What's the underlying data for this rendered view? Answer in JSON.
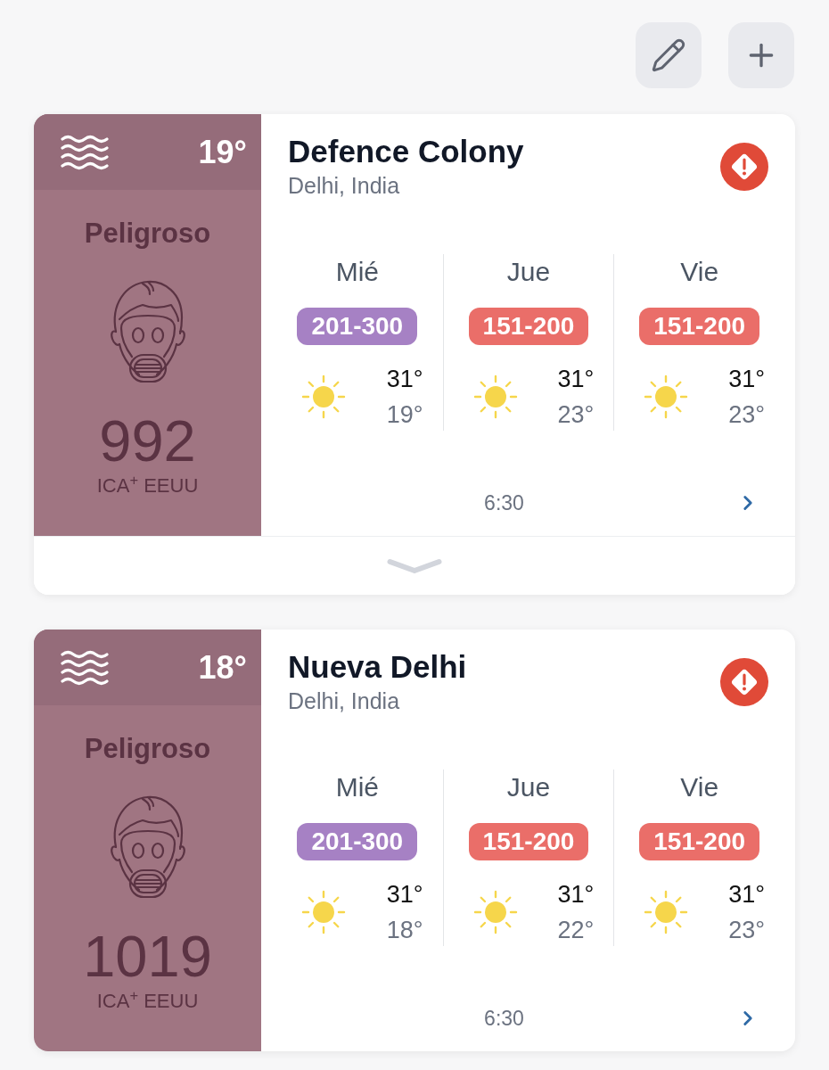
{
  "cards": [
    {
      "temperature": "19°",
      "aqi_label": "Peligroso",
      "aqi_value": "992",
      "aqi_scale": "ICA$^{+}$ EEUU",
      "name": "Defence Colony",
      "region": "Delhi, India",
      "alert": true,
      "forecast": [
        {
          "day": "Mié",
          "aqi_range": "201-300",
          "color": "#a681c4",
          "high": "31°",
          "low": "19°"
        },
        {
          "day": "Jue",
          "aqi_range": "151-200",
          "color": "#ea6e69",
          "high": "31°",
          "low": "23°"
        },
        {
          "day": "Vie",
          "aqi_range": "151-200",
          "color": "#ea6e69",
          "high": "31°",
          "low": "23°"
        }
      ],
      "updated": "6:30",
      "expand_toggle": true
    },
    {
      "temperature": "18°",
      "aqi_label": "Peligroso",
      "aqi_value": "1019",
      "aqi_scale": "ICA$^{+}$ EEUU",
      "name": "Nueva Delhi",
      "region": "Delhi, India",
      "alert": true,
      "forecast": [
        {
          "day": "Mié",
          "aqi_range": "201-300",
          "color": "#a681c4",
          "high": "31°",
          "low": "18°"
        },
        {
          "day": "Jue",
          "aqi_range": "151-200",
          "color": "#ea6e69",
          "high": "31°",
          "low": "22°"
        },
        {
          "day": "Vie",
          "aqi_range": "151-200",
          "color": "#ea6e69",
          "high": "31°",
          "low": "23°"
        }
      ],
      "updated": "6:30",
      "expand_toggle": false
    }
  ]
}
